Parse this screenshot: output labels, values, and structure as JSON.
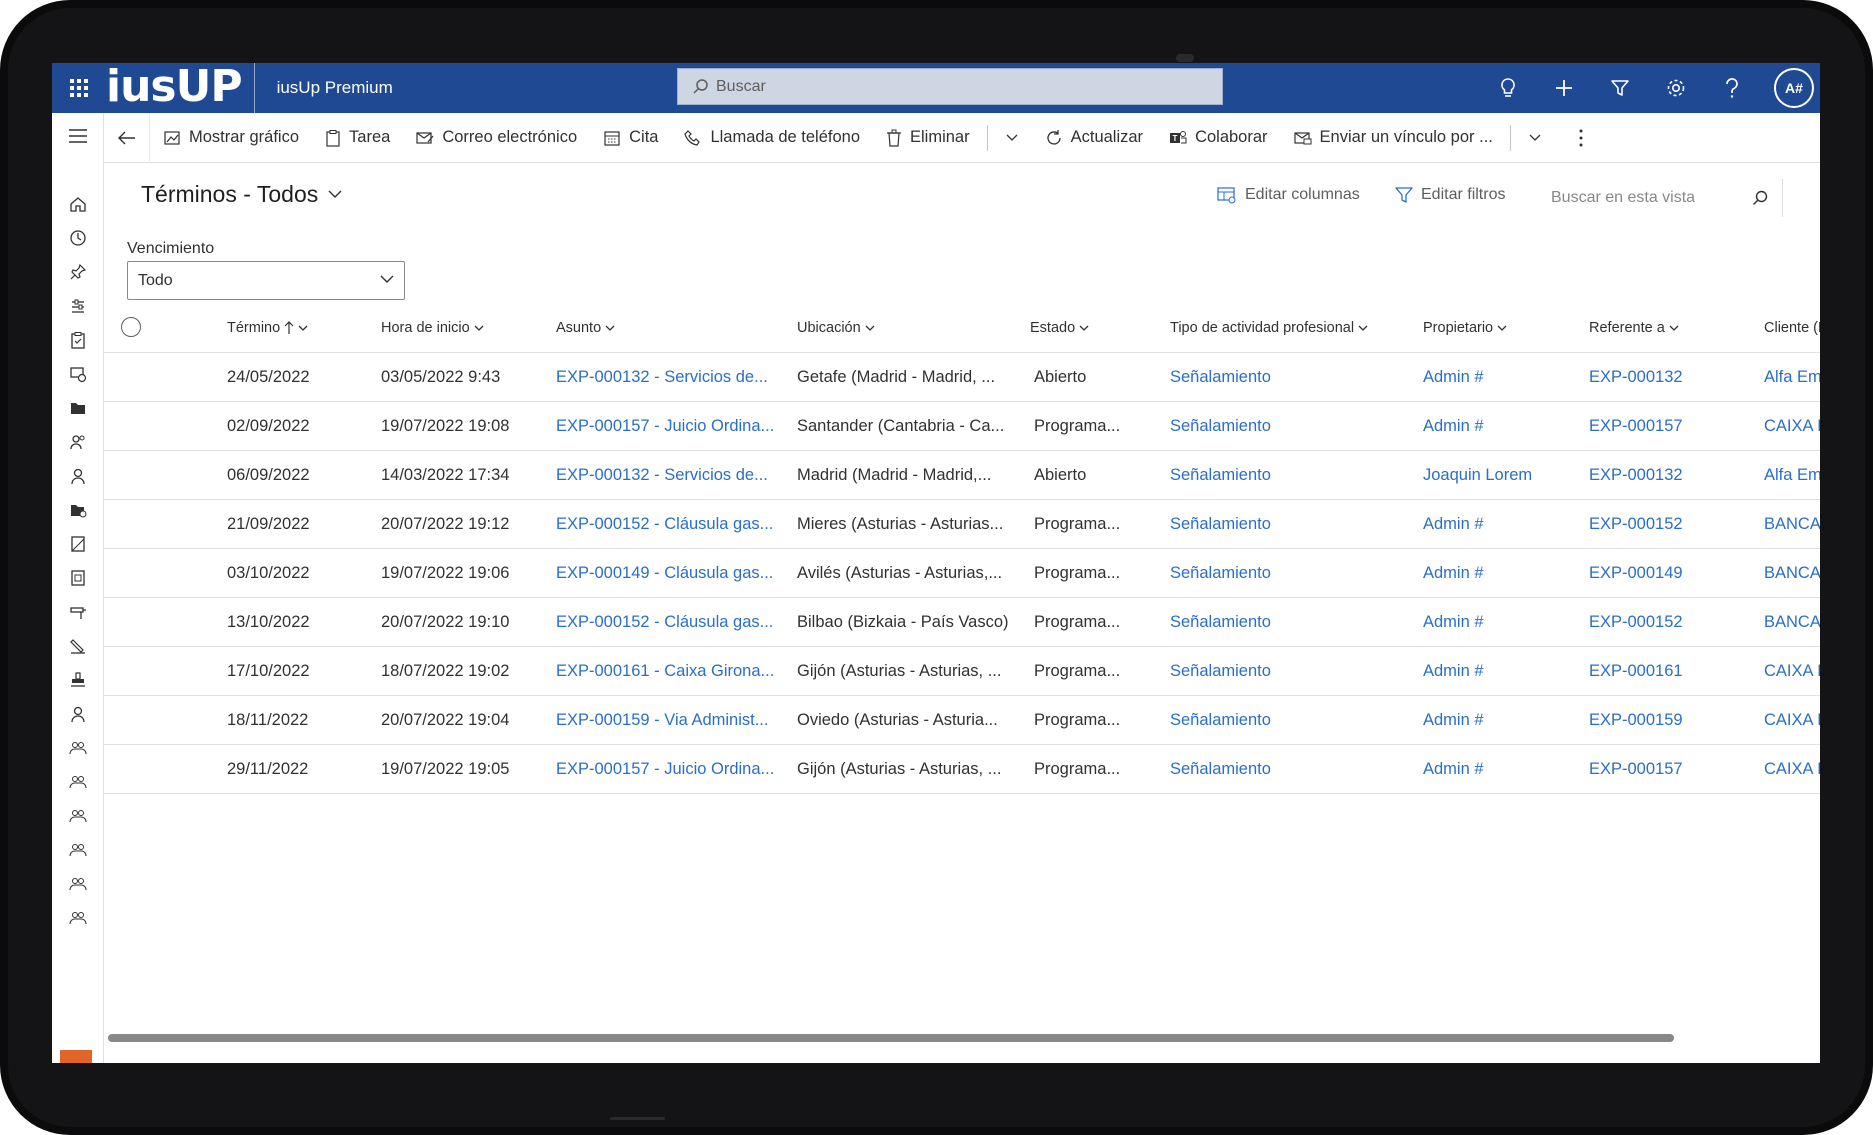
{
  "topbar": {
    "logo": "iusUP",
    "app_name": "iusUp Premium",
    "search_placeholder": "Buscar",
    "icons": [
      "lightbulb-icon",
      "plus-icon",
      "filter-icon",
      "gear-icon",
      "help-icon"
    ],
    "avatar_initials": "A#"
  },
  "command_bar": {
    "items": [
      {
        "label": "Mostrar gráfico",
        "icon": "chart-icon"
      },
      {
        "label": "Tarea",
        "icon": "task-icon"
      },
      {
        "label": "Correo electrónico",
        "icon": "email-icon"
      },
      {
        "label": "Cita",
        "icon": "calendar-icon"
      },
      {
        "label": "Llamada de teléfono",
        "icon": "phone-icon"
      },
      {
        "label": "Eliminar",
        "icon": "trash-icon"
      },
      {
        "label": "Actualizar",
        "icon": "refresh-icon"
      },
      {
        "label": "Colaborar",
        "icon": "teams-icon"
      },
      {
        "label": "Enviar un vínculo por ...",
        "icon": "send-link-icon"
      }
    ]
  },
  "view": {
    "title": "Términos - Todos",
    "edit_columns": "Editar columnas",
    "edit_filters": "Editar filtros",
    "search_placeholder": "Buscar en esta vista",
    "filter_label": "Vencimiento",
    "filter_value": "Todo"
  },
  "grid": {
    "columns": [
      "Término",
      "Hora de inicio",
      "Asunto",
      "Ubicación",
      "Estado",
      "Tipo de actividad profesional",
      "Propietario",
      "Referente a",
      "Cliente (Refe"
    ],
    "rows": [
      [
        "24/05/2022",
        "03/05/2022 9:43",
        "EXP-000132 - Servicios de...",
        "Getafe (Madrid - Madrid, ...",
        "Abierto",
        "Señalamiento",
        "Admin #",
        "EXP-000132",
        "Alfa Empre"
      ],
      [
        "02/09/2022",
        "19/07/2022 19:08",
        "EXP-000157 - Juicio Ordina...",
        "Santander (Cantabria - Ca...",
        "Programa...",
        "Señalamiento",
        "Admin #",
        "EXP-000157",
        "CAIXA FAR"
      ],
      [
        "06/09/2022",
        "14/03/2022 17:34",
        "EXP-000132 - Servicios de...",
        "Madrid (Madrid - Madrid,...",
        "Abierto",
        "Señalamiento",
        "Joaquin Lorem",
        "EXP-000132",
        "Alfa Empre"
      ],
      [
        "21/09/2022",
        "20/07/2022 19:12",
        "EXP-000152 - Cláusula gas...",
        "Mieres (Asturias - Asturias...",
        "Programa...",
        "Señalamiento",
        "Admin #",
        "EXP-000152",
        "BANCA DE"
      ],
      [
        "03/10/2022",
        "19/07/2022 19:06",
        "EXP-000149 - Cláusula gas...",
        "Avilés (Asturias - Asturias,...",
        "Programa...",
        "Señalamiento",
        "Admin #",
        "EXP-000149",
        "BANCA DE"
      ],
      [
        "13/10/2022",
        "20/07/2022 19:10",
        "EXP-000152 - Cláusula gas...",
        "Bilbao (Bizkaia - País Vasco)",
        "Programa...",
        "Señalamiento",
        "Admin #",
        "EXP-000152",
        "BANCA DE"
      ],
      [
        "17/10/2022",
        "18/07/2022 19:02",
        "EXP-000161 - Caixa Girona...",
        "Gijón (Asturias - Asturias, ...",
        "Programa...",
        "Señalamiento",
        "Admin #",
        "EXP-000161",
        "CAIXA FAR"
      ],
      [
        "18/11/2022",
        "20/07/2022 19:04",
        "EXP-000159 - Via Administ...",
        "Oviedo (Asturias - Asturia...",
        "Programa...",
        "Señalamiento",
        "Admin #",
        "EXP-000159",
        "CAIXA FAR"
      ],
      [
        "29/11/2022",
        "19/07/2022 19:05",
        "EXP-000157 - Juicio Ordina...",
        "Gijón (Asturias - Asturias, ...",
        "Programa...",
        "Señalamiento",
        "Admin #",
        "EXP-000157",
        "CAIXA FAR"
      ]
    ]
  },
  "left_nav": {
    "icons": [
      "home-icon",
      "recent-icon",
      "pin-icon",
      "settings-sliders-icon",
      "clipboard-icon",
      "dashboard-icon",
      "folder-icon",
      "contacts-icon",
      "person-icon",
      "folder-settings-icon",
      "document-icon",
      "notebook-icon",
      "tool-icon",
      "pen-icon",
      "stamp-icon",
      "user-icon",
      "team-icon",
      "team-icon",
      "team-icon",
      "team-icon",
      "team-icon",
      "team-icon"
    ]
  },
  "colors": {
    "topbar": "#1f4a93",
    "link": "#2b6fc4",
    "accent_orange": "#e16529"
  }
}
